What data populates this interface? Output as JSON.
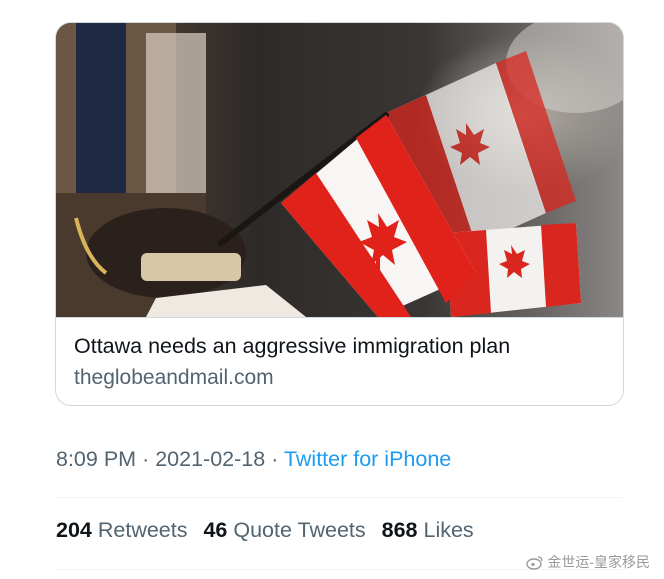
{
  "link_card": {
    "title": "Ottawa needs an aggressive immigration plan",
    "domain": "theglobeandmail.com"
  },
  "tweet_meta": {
    "time": "8:09 PM",
    "separator": "·",
    "date": "2021-02-18",
    "source": "Twitter for iPhone"
  },
  "stats": {
    "retweets_count": "204",
    "retweets_label": "Retweets",
    "quotes_count": "46",
    "quotes_label": "Quote Tweets",
    "likes_count": "868",
    "likes_label": "Likes"
  },
  "watermark": {
    "icon": "weibo-icon",
    "text": "金世运-皇家移民"
  },
  "colors": {
    "text_primary": "#0f1419",
    "text_secondary": "#536471",
    "link": "#1d9bf0",
    "border": "#cfd9de",
    "flag_red": "#e0221b"
  }
}
